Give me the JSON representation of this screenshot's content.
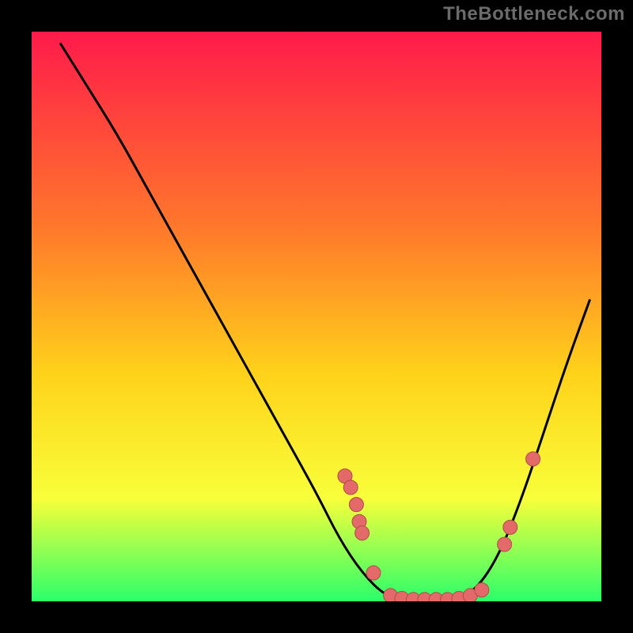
{
  "watermark": "TheBottleneck.com",
  "colors": {
    "background": "#000000",
    "gradient_top": "#ff1a4a",
    "gradient_mid1": "#ff7a2a",
    "gradient_mid2": "#ffd21a",
    "gradient_mid3": "#f8ff3a",
    "gradient_bottom": "#2aff6a",
    "curve": "#000000",
    "dot_fill": "#e46a6a",
    "dot_stroke": "#b04a4a"
  },
  "chart_data": {
    "type": "line",
    "title": "",
    "xlabel": "",
    "ylabel": "",
    "xlim": [
      0,
      100
    ],
    "ylim": [
      0,
      100
    ],
    "series": [
      {
        "name": "bottleneck-curve",
        "x": [
          5,
          10,
          15,
          20,
          25,
          30,
          35,
          40,
          45,
          50,
          54,
          58,
          62,
          66,
          70,
          74,
          78,
          82,
          86,
          90,
          94,
          98
        ],
        "y": [
          98,
          90,
          82,
          73,
          64,
          55,
          46,
          37,
          28,
          19,
          11,
          5,
          1,
          0,
          0,
          0,
          2,
          8,
          18,
          30,
          42,
          53
        ]
      }
    ],
    "dots": [
      {
        "x": 55,
        "y": 22
      },
      {
        "x": 56,
        "y": 20
      },
      {
        "x": 57,
        "y": 17
      },
      {
        "x": 57.5,
        "y": 14
      },
      {
        "x": 58,
        "y": 12
      },
      {
        "x": 60,
        "y": 5
      },
      {
        "x": 63,
        "y": 1
      },
      {
        "x": 65,
        "y": 0.5
      },
      {
        "x": 67,
        "y": 0.3
      },
      {
        "x": 69,
        "y": 0.3
      },
      {
        "x": 71,
        "y": 0.3
      },
      {
        "x": 73,
        "y": 0.3
      },
      {
        "x": 75,
        "y": 0.5
      },
      {
        "x": 77,
        "y": 1
      },
      {
        "x": 79,
        "y": 2
      },
      {
        "x": 83,
        "y": 10
      },
      {
        "x": 84,
        "y": 13
      },
      {
        "x": 88,
        "y": 25
      }
    ]
  }
}
